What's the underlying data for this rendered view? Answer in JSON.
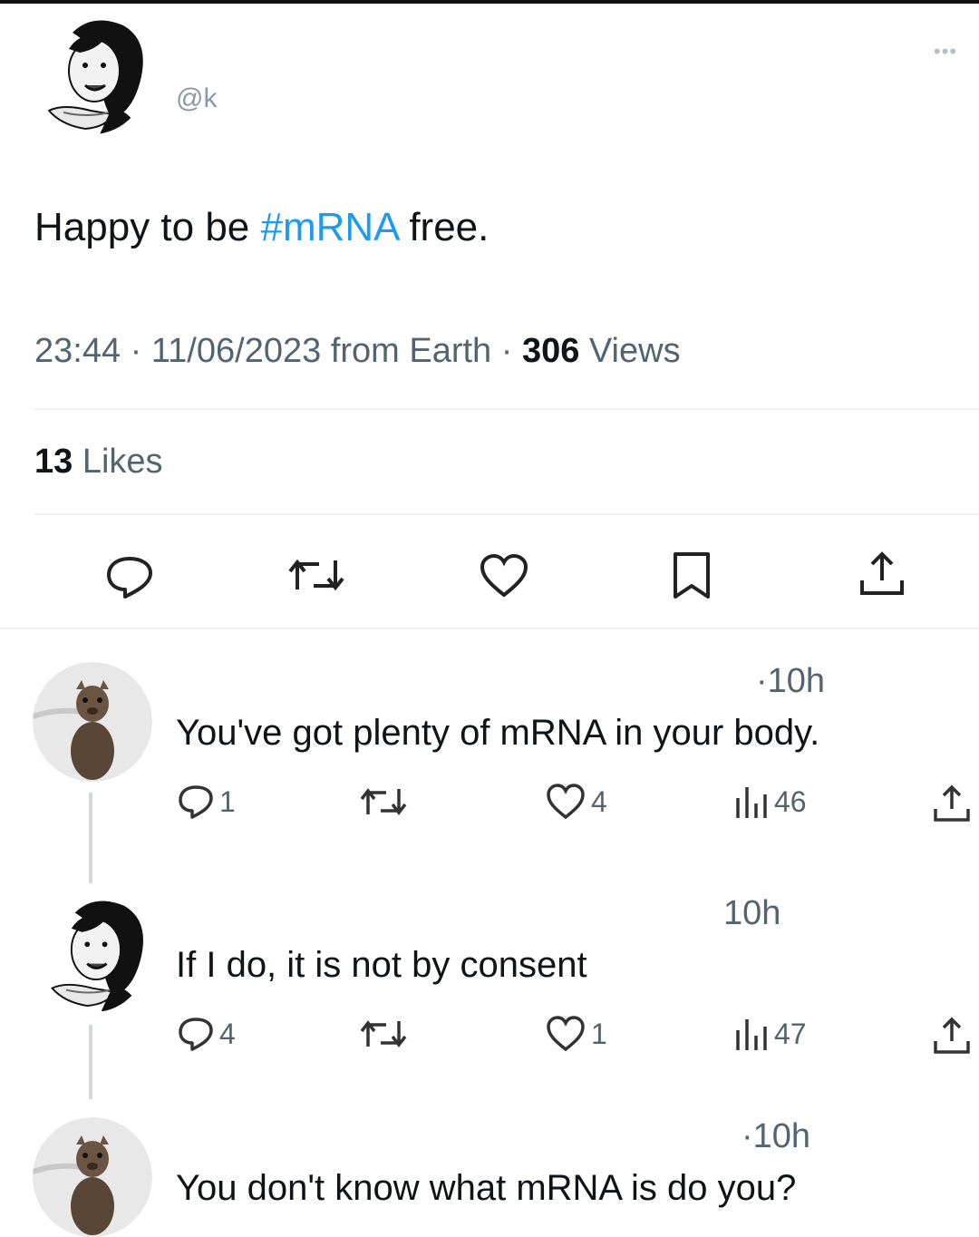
{
  "tweet": {
    "handle": "@k",
    "text_prefix": "Happy to be ",
    "hashtag": "#mRNA",
    "text_suffix": " free.",
    "meta_prefix": "23:44 · 11/06/2023 from Earth · ",
    "views_count": "306",
    "views_label": " Views",
    "likes_count": "13",
    "likes_label": " Likes",
    "actions": [
      "reply",
      "retweet",
      "like",
      "bookmark",
      "share"
    ]
  },
  "replies": [
    {
      "time": "·10h",
      "text": "You've got plenty of mRNA in your body.",
      "reply_count": "1",
      "like_count": "4",
      "view_count": "46"
    },
    {
      "time": "10h",
      "text": "If I do, it is not by consent",
      "reply_count": "4",
      "like_count": "1",
      "view_count": "47"
    },
    {
      "time": "·10h",
      "text": "You don't know what mRNA is do you?"
    }
  ],
  "colors": {
    "accent": "#1d9bf0",
    "secondary_text": "#536471",
    "primary_text": "#0f1419",
    "divider": "#eff3f4"
  }
}
